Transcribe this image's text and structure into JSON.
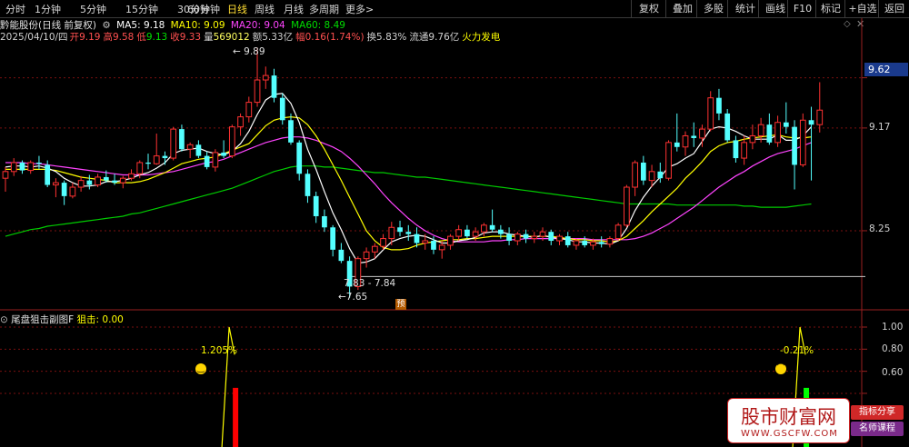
{
  "toolbar": {
    "periods": [
      "分时",
      "1分钟",
      "5分钟",
      "15分钟",
      "30分钟",
      "60分钟",
      "日线",
      "周线",
      "月线",
      "多周期",
      "更多>"
    ],
    "active_period": "日线",
    "right_buttons": [
      "复权",
      "叠加",
      "多股",
      "统计",
      "画线",
      "F10",
      "标记",
      "+自选",
      "返回"
    ]
  },
  "header": {
    "stock": "黔能股份(日线 前复权)",
    "ma5_label": "MA5: 9.18",
    "ma10_label": "MA10: 9.09",
    "ma20_label": "MA20: 9.04",
    "ma60_label": "MA60: 8.49",
    "date": "2025/04/10/四",
    "open_label": "开",
    "open": "9.19",
    "high_label": "高",
    "high": "9.58",
    "low_label": "低",
    "low": "9.13",
    "close_label": "收",
    "close": "9.33",
    "vol_label": "量",
    "vol": "569012",
    "amount_label": "额",
    "amount": "5.33亿",
    "change_label": "幅",
    "change": "0.16(1.74%)",
    "turnover_label": "换",
    "turnover": "5.83%",
    "float_label": "流通",
    "float": "9.76亿",
    "concept": "火力发电"
  },
  "colors": {
    "up": "#ff3232",
    "down": "#54ffff",
    "ma5": "#ffffff",
    "ma10": "#ffff00",
    "ma20": "#ff44ff",
    "ma60": "#00cc00",
    "yellow": "#ffff00",
    "red_bar": "#ff0000",
    "green_bar": "#00ff00",
    "grid": "#7a1010",
    "axis": "#9a2020"
  },
  "subchart": {
    "title": "尾盘狙击副图F",
    "signal_label": "狙击: 0.00",
    "yticks": [
      "1.00",
      "0.80",
      "0.60",
      "0.40"
    ]
  },
  "watermark": {
    "main": "股市财富网",
    "url": "WWW.GSCFW.COM",
    "tag1": "指标分享",
    "tag2": "名师课程"
  },
  "chart_data": {
    "type": "candlestick",
    "ylim": [
      7.55,
      9.95
    ],
    "yticks": [
      9.62,
      9.17,
      8.25
    ],
    "current_price_tag": "9.62",
    "annotations": [
      "9.89",
      "7.83 - 7.84",
      "←7.65",
      "预"
    ],
    "candles": [
      {
        "o": 8.72,
        "h": 8.82,
        "l": 8.6,
        "c": 8.78
      },
      {
        "o": 8.78,
        "h": 8.9,
        "l": 8.74,
        "c": 8.86
      },
      {
        "o": 8.86,
        "h": 8.88,
        "l": 8.76,
        "c": 8.79
      },
      {
        "o": 8.79,
        "h": 8.88,
        "l": 8.76,
        "c": 8.86
      },
      {
        "o": 8.86,
        "h": 8.92,
        "l": 8.8,
        "c": 8.85
      },
      {
        "o": 8.84,
        "h": 8.88,
        "l": 8.64,
        "c": 8.66
      },
      {
        "o": 8.66,
        "h": 8.72,
        "l": 8.55,
        "c": 8.68
      },
      {
        "o": 8.68,
        "h": 8.7,
        "l": 8.48,
        "c": 8.56
      },
      {
        "o": 8.56,
        "h": 8.68,
        "l": 8.54,
        "c": 8.64
      },
      {
        "o": 8.64,
        "h": 8.74,
        "l": 8.6,
        "c": 8.7
      },
      {
        "o": 8.7,
        "h": 8.75,
        "l": 8.62,
        "c": 8.66
      },
      {
        "o": 8.66,
        "h": 8.76,
        "l": 8.64,
        "c": 8.73
      },
      {
        "o": 8.73,
        "h": 8.79,
        "l": 8.68,
        "c": 8.7
      },
      {
        "o": 8.7,
        "h": 8.76,
        "l": 8.66,
        "c": 8.68
      },
      {
        "o": 8.68,
        "h": 8.74,
        "l": 8.63,
        "c": 8.72
      },
      {
        "o": 8.72,
        "h": 8.8,
        "l": 8.7,
        "c": 8.76
      },
      {
        "o": 8.76,
        "h": 8.88,
        "l": 8.72,
        "c": 8.86
      },
      {
        "o": 8.86,
        "h": 8.94,
        "l": 8.8,
        "c": 8.85
      },
      {
        "o": 8.85,
        "h": 9.12,
        "l": 8.84,
        "c": 8.92
      },
      {
        "o": 8.92,
        "h": 8.96,
        "l": 8.84,
        "c": 8.9
      },
      {
        "o": 8.9,
        "h": 9.18,
        "l": 8.88,
        "c": 9.16
      },
      {
        "o": 9.16,
        "h": 9.2,
        "l": 8.96,
        "c": 8.98
      },
      {
        "o": 8.98,
        "h": 9.04,
        "l": 8.9,
        "c": 9.02
      },
      {
        "o": 9.02,
        "h": 9.06,
        "l": 8.9,
        "c": 8.92
      },
      {
        "o": 8.92,
        "h": 8.96,
        "l": 8.8,
        "c": 8.82
      },
      {
        "o": 8.82,
        "h": 8.98,
        "l": 8.78,
        "c": 8.95
      },
      {
        "o": 8.95,
        "h": 9.06,
        "l": 8.9,
        "c": 8.92
      },
      {
        "o": 8.92,
        "h": 9.2,
        "l": 8.9,
        "c": 9.18
      },
      {
        "o": 9.18,
        "h": 9.3,
        "l": 9.1,
        "c": 9.27
      },
      {
        "o": 9.27,
        "h": 9.45,
        "l": 9.22,
        "c": 9.4
      },
      {
        "o": 9.4,
        "h": 9.89,
        "l": 9.36,
        "c": 9.6
      },
      {
        "o": 9.6,
        "h": 9.72,
        "l": 9.52,
        "c": 9.64
      },
      {
        "o": 9.64,
        "h": 9.7,
        "l": 9.4,
        "c": 9.44
      },
      {
        "o": 9.44,
        "h": 9.48,
        "l": 9.2,
        "c": 9.24
      },
      {
        "o": 9.24,
        "h": 9.3,
        "l": 9.02,
        "c": 9.04
      },
      {
        "o": 9.04,
        "h": 9.06,
        "l": 8.7,
        "c": 8.76
      },
      {
        "o": 8.76,
        "h": 8.8,
        "l": 8.5,
        "c": 8.56
      },
      {
        "o": 8.56,
        "h": 8.6,
        "l": 8.32,
        "c": 8.38
      },
      {
        "o": 8.38,
        "h": 8.44,
        "l": 8.24,
        "c": 8.28
      },
      {
        "o": 8.28,
        "h": 8.3,
        "l": 8.02,
        "c": 8.08
      },
      {
        "o": 8.08,
        "h": 8.14,
        "l": 7.96,
        "c": 7.98
      },
      {
        "o": 7.98,
        "h": 8.02,
        "l": 7.65,
        "c": 7.75
      },
      {
        "o": 7.75,
        "h": 8.02,
        "l": 7.72,
        "c": 8.0
      },
      {
        "o": 8.0,
        "h": 8.1,
        "l": 7.92,
        "c": 8.06
      },
      {
        "o": 8.06,
        "h": 8.14,
        "l": 8.0,
        "c": 8.11
      },
      {
        "o": 8.11,
        "h": 8.22,
        "l": 8.08,
        "c": 8.18
      },
      {
        "o": 8.18,
        "h": 8.33,
        "l": 8.12,
        "c": 8.28
      },
      {
        "o": 8.28,
        "h": 8.34,
        "l": 8.2,
        "c": 8.24
      },
      {
        "o": 8.24,
        "h": 8.3,
        "l": 8.16,
        "c": 8.22
      },
      {
        "o": 8.22,
        "h": 8.28,
        "l": 8.1,
        "c": 8.14
      },
      {
        "o": 8.14,
        "h": 8.22,
        "l": 8.08,
        "c": 8.16
      },
      {
        "o": 8.16,
        "h": 8.2,
        "l": 8.04,
        "c": 8.08
      },
      {
        "o": 8.08,
        "h": 8.16,
        "l": 8.0,
        "c": 8.12
      },
      {
        "o": 8.12,
        "h": 8.22,
        "l": 8.08,
        "c": 8.2
      },
      {
        "o": 8.2,
        "h": 8.3,
        "l": 8.16,
        "c": 8.26
      },
      {
        "o": 8.26,
        "h": 8.3,
        "l": 8.18,
        "c": 8.2
      },
      {
        "o": 8.2,
        "h": 8.28,
        "l": 8.16,
        "c": 8.24
      },
      {
        "o": 8.24,
        "h": 8.32,
        "l": 8.2,
        "c": 8.3
      },
      {
        "o": 8.3,
        "h": 8.44,
        "l": 8.24,
        "c": 8.26
      },
      {
        "o": 8.26,
        "h": 8.3,
        "l": 8.18,
        "c": 8.22
      },
      {
        "o": 8.22,
        "h": 8.28,
        "l": 8.12,
        "c": 8.16
      },
      {
        "o": 8.16,
        "h": 8.24,
        "l": 8.12,
        "c": 8.22
      },
      {
        "o": 8.22,
        "h": 8.26,
        "l": 8.14,
        "c": 8.18
      },
      {
        "o": 8.18,
        "h": 8.24,
        "l": 8.14,
        "c": 8.2
      },
      {
        "o": 8.2,
        "h": 8.28,
        "l": 8.16,
        "c": 8.24
      },
      {
        "o": 8.24,
        "h": 8.26,
        "l": 8.12,
        "c": 8.16
      },
      {
        "o": 8.16,
        "h": 8.22,
        "l": 8.12,
        "c": 8.2
      },
      {
        "o": 8.2,
        "h": 8.24,
        "l": 8.1,
        "c": 8.12
      },
      {
        "o": 8.12,
        "h": 8.18,
        "l": 8.08,
        "c": 8.16
      },
      {
        "o": 8.16,
        "h": 8.2,
        "l": 8.1,
        "c": 8.12
      },
      {
        "o": 8.12,
        "h": 8.18,
        "l": 8.08,
        "c": 8.15
      },
      {
        "o": 8.15,
        "h": 8.2,
        "l": 8.1,
        "c": 8.13
      },
      {
        "o": 8.13,
        "h": 8.2,
        "l": 8.1,
        "c": 8.18
      },
      {
        "o": 8.18,
        "h": 8.32,
        "l": 8.16,
        "c": 8.3
      },
      {
        "o": 8.3,
        "h": 8.66,
        "l": 8.28,
        "c": 8.64
      },
      {
        "o": 8.64,
        "h": 8.88,
        "l": 8.56,
        "c": 8.86
      },
      {
        "o": 8.86,
        "h": 8.92,
        "l": 8.66,
        "c": 8.7
      },
      {
        "o": 8.7,
        "h": 8.84,
        "l": 8.64,
        "c": 8.78
      },
      {
        "o": 8.78,
        "h": 8.86,
        "l": 8.68,
        "c": 8.72
      },
      {
        "o": 8.72,
        "h": 9.06,
        "l": 8.7,
        "c": 9.04
      },
      {
        "o": 9.04,
        "h": 9.3,
        "l": 8.96,
        "c": 9.0
      },
      {
        "o": 9.0,
        "h": 9.14,
        "l": 8.92,
        "c": 9.1
      },
      {
        "o": 9.1,
        "h": 9.22,
        "l": 9.0,
        "c": 9.08
      },
      {
        "o": 9.08,
        "h": 9.2,
        "l": 9.0,
        "c": 9.16
      },
      {
        "o": 9.16,
        "h": 9.5,
        "l": 9.14,
        "c": 9.44
      },
      {
        "o": 9.44,
        "h": 9.52,
        "l": 9.24,
        "c": 9.3
      },
      {
        "o": 9.3,
        "h": 9.34,
        "l": 9.04,
        "c": 9.06
      },
      {
        "o": 9.06,
        "h": 9.1,
        "l": 8.86,
        "c": 8.9
      },
      {
        "o": 8.9,
        "h": 9.1,
        "l": 8.84,
        "c": 9.04
      },
      {
        "o": 9.04,
        "h": 9.2,
        "l": 8.98,
        "c": 9.1
      },
      {
        "o": 9.1,
        "h": 9.26,
        "l": 9.04,
        "c": 9.2
      },
      {
        "o": 9.2,
        "h": 9.3,
        "l": 9.02,
        "c": 9.04
      },
      {
        "o": 9.04,
        "h": 9.28,
        "l": 9.0,
        "c": 9.22
      },
      {
        "o": 9.22,
        "h": 9.4,
        "l": 9.12,
        "c": 9.18
      },
      {
        "o": 9.18,
        "h": 9.24,
        "l": 8.62,
        "c": 8.84
      },
      {
        "o": 8.84,
        "h": 9.3,
        "l": 8.82,
        "c": 9.24
      },
      {
        "o": 9.24,
        "h": 9.36,
        "l": 8.7,
        "c": 9.2
      },
      {
        "o": 9.2,
        "h": 9.58,
        "l": 9.13,
        "c": 9.33
      }
    ],
    "ma5": [
      8.82,
      8.83,
      8.83,
      8.82,
      8.83,
      8.81,
      8.78,
      8.72,
      8.68,
      8.65,
      8.65,
      8.66,
      8.69,
      8.69,
      8.7,
      8.72,
      8.75,
      8.77,
      8.81,
      8.86,
      8.94,
      8.97,
      8.98,
      8.99,
      8.96,
      8.94,
      8.93,
      8.96,
      9.03,
      9.14,
      9.29,
      9.42,
      9.47,
      9.48,
      9.39,
      9.22,
      8.98,
      8.8,
      8.6,
      8.41,
      8.26,
      8.09,
      7.96,
      7.97,
      8.0,
      8.08,
      8.15,
      8.18,
      8.2,
      8.21,
      8.2,
      8.17,
      8.14,
      8.14,
      8.16,
      8.17,
      8.19,
      8.23,
      8.24,
      8.24,
      8.22,
      8.21,
      8.2,
      8.19,
      8.21,
      8.19,
      8.18,
      8.17,
      8.15,
      8.15,
      8.14,
      8.14,
      8.13,
      8.16,
      8.27,
      8.43,
      8.55,
      8.65,
      8.73,
      8.82,
      8.85,
      8.9,
      8.94,
      9.05,
      9.16,
      9.18,
      9.17,
      9.14,
      9.1,
      9.07,
      9.07,
      9.07,
      9.11,
      9.06,
      9.06,
      9.1,
      9.18
    ],
    "ma10": [
      8.8,
      8.8,
      8.8,
      8.8,
      8.8,
      8.8,
      8.79,
      8.77,
      8.75,
      8.73,
      8.72,
      8.71,
      8.7,
      8.68,
      8.68,
      8.68,
      8.69,
      8.71,
      8.74,
      8.77,
      8.81,
      8.85,
      8.87,
      8.89,
      8.9,
      8.91,
      8.94,
      8.97,
      9.0,
      9.03,
      9.11,
      9.19,
      9.24,
      9.26,
      9.27,
      9.26,
      9.2,
      9.1,
      8.98,
      8.84,
      8.7,
      8.55,
      8.4,
      8.25,
      8.16,
      8.1,
      8.08,
      8.08,
      8.09,
      8.12,
      8.14,
      8.15,
      8.16,
      8.17,
      8.17,
      8.18,
      8.18,
      8.19,
      8.2,
      8.2,
      8.2,
      8.2,
      8.2,
      8.2,
      8.2,
      8.2,
      8.19,
      8.18,
      8.17,
      8.17,
      8.16,
      8.16,
      8.15,
      8.16,
      8.2,
      8.27,
      8.34,
      8.42,
      8.49,
      8.56,
      8.63,
      8.72,
      8.79,
      8.87,
      8.96,
      9.01,
      9.04,
      9.05,
      9.07,
      9.08,
      9.09,
      9.1,
      9.11,
      9.09,
      9.08,
      9.08,
      9.09
    ],
    "ma20": [
      8.86,
      8.86,
      8.86,
      8.85,
      8.85,
      8.84,
      8.83,
      8.82,
      8.81,
      8.8,
      8.79,
      8.78,
      8.77,
      8.76,
      8.75,
      8.75,
      8.75,
      8.75,
      8.76,
      8.77,
      8.78,
      8.8,
      8.82,
      8.84,
      8.86,
      8.87,
      8.89,
      8.92,
      8.95,
      8.98,
      9.01,
      9.04,
      9.06,
      9.08,
      9.09,
      9.09,
      9.08,
      9.06,
      9.03,
      9.0,
      8.96,
      8.9,
      8.83,
      8.75,
      8.67,
      8.58,
      8.5,
      8.43,
      8.36,
      8.3,
      8.25,
      8.21,
      8.18,
      8.16,
      8.15,
      8.15,
      8.15,
      8.15,
      8.16,
      8.16,
      8.17,
      8.17,
      8.18,
      8.18,
      8.18,
      8.18,
      8.18,
      8.18,
      8.18,
      8.18,
      8.17,
      8.17,
      8.17,
      8.17,
      8.17,
      8.18,
      8.2,
      8.23,
      8.27,
      8.31,
      8.36,
      8.41,
      8.46,
      8.52,
      8.58,
      8.64,
      8.69,
      8.74,
      8.78,
      8.83,
      8.87,
      8.91,
      8.94,
      8.96,
      8.98,
      9.01,
      9.04
    ],
    "ma60": [
      8.2,
      8.22,
      8.24,
      8.26,
      8.27,
      8.29,
      8.3,
      8.31,
      8.32,
      8.33,
      8.34,
      8.35,
      8.36,
      8.37,
      8.38,
      8.4,
      8.41,
      8.43,
      8.45,
      8.47,
      8.49,
      8.51,
      8.53,
      8.55,
      8.57,
      8.59,
      8.61,
      8.63,
      8.66,
      8.69,
      8.72,
      8.75,
      8.78,
      8.8,
      8.82,
      8.83,
      8.83,
      8.83,
      8.82,
      8.82,
      8.81,
      8.8,
      8.79,
      8.78,
      8.77,
      8.77,
      8.76,
      8.75,
      8.74,
      8.73,
      8.73,
      8.72,
      8.71,
      8.7,
      8.69,
      8.68,
      8.67,
      8.66,
      8.65,
      8.64,
      8.63,
      8.62,
      8.61,
      8.6,
      8.59,
      8.58,
      8.57,
      8.56,
      8.55,
      8.54,
      8.53,
      8.52,
      8.51,
      8.5,
      8.49,
      8.49,
      8.49,
      8.49,
      8.49,
      8.49,
      8.48,
      8.48,
      8.48,
      8.48,
      8.48,
      8.48,
      8.48,
      8.48,
      8.47,
      8.47,
      8.46,
      8.46,
      8.46,
      8.46,
      8.47,
      8.48,
      8.49
    ],
    "support_line": 7.84,
    "sub_ylim": [
      0,
      1.0
    ],
    "sub_signals": [
      {
        "bar_index": 26,
        "value": 1.0,
        "label": "1.205%",
        "bar_color": "red",
        "bar_top": 0.45
      },
      {
        "bar_index": 94,
        "value": 1.0,
        "label": "-0.21%",
        "bar_color": "green",
        "bar_top": 0.45
      }
    ]
  }
}
